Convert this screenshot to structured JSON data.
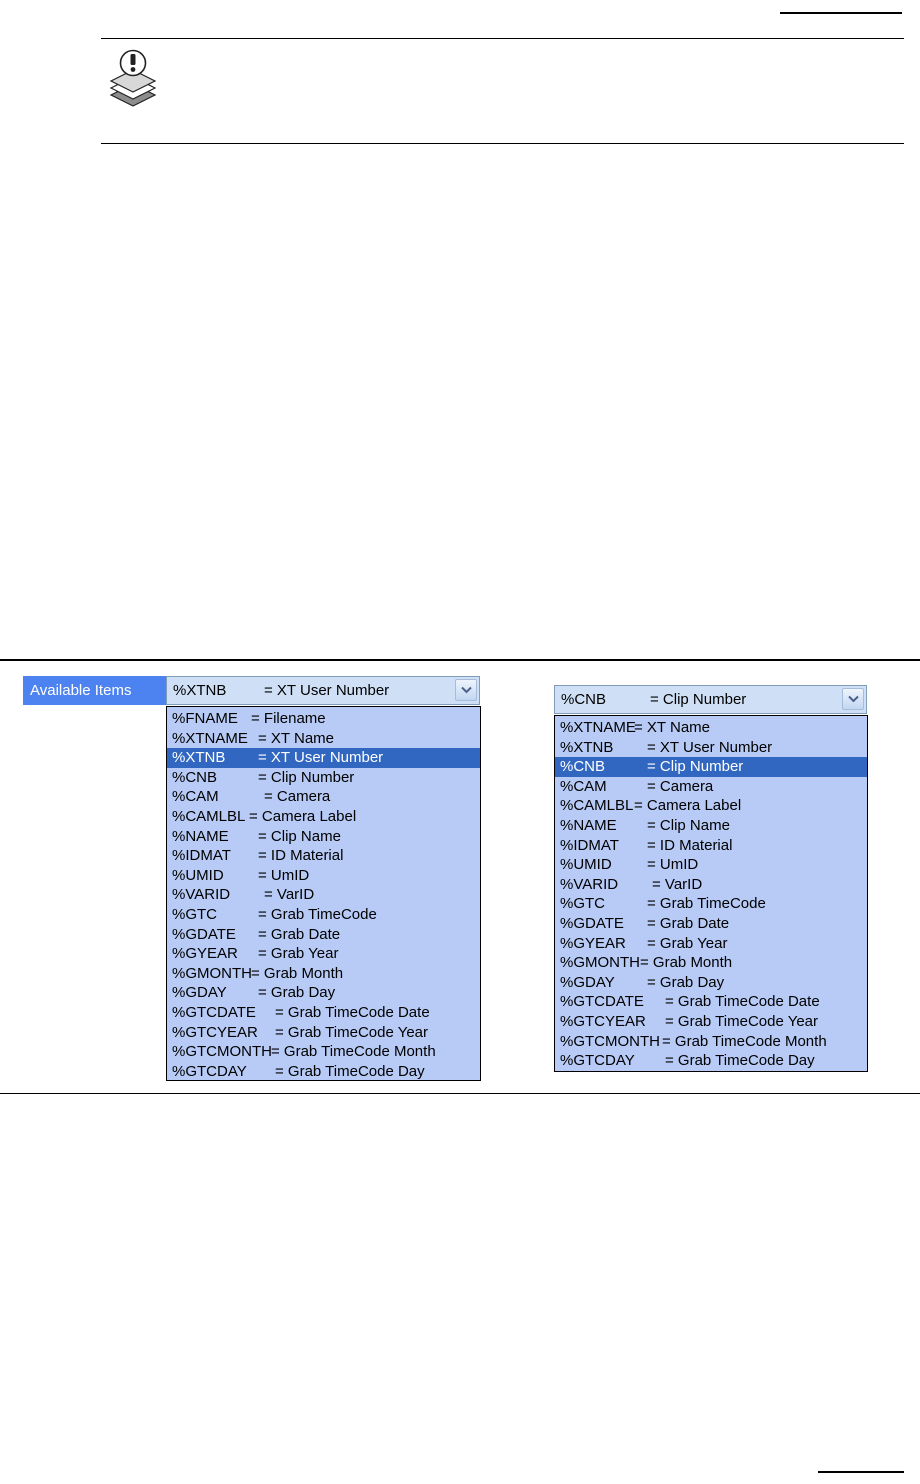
{
  "figure": {
    "label": "Available Items",
    "left_dropdown": {
      "selected": {
        "code": "%XTNB",
        "desc": "= XT User Number"
      },
      "items": [
        {
          "code": "%FNAME",
          "desc": "= Filename"
        },
        {
          "code": "%XTNAME",
          "desc": "= XT Name"
        },
        {
          "code": "%XTNB",
          "desc": "= XT User Number",
          "selected": true
        },
        {
          "code": "%CNB",
          "desc": "= Clip Number"
        },
        {
          "code": "%CAM",
          "desc": "= Camera"
        },
        {
          "code": "%CAMLBL",
          "desc": "= Camera Label"
        },
        {
          "code": "%NAME",
          "desc": "= Clip Name"
        },
        {
          "code": "%IDMAT",
          "desc": "= ID Material"
        },
        {
          "code": "%UMID",
          "desc": "= UmID"
        },
        {
          "code": "%VARID",
          "desc": "= VarID"
        },
        {
          "code": "%GTC",
          "desc": "= Grab TimeCode"
        },
        {
          "code": "%GDATE",
          "desc": "= Grab Date"
        },
        {
          "code": "%GYEAR",
          "desc": "= Grab Year"
        },
        {
          "code": "%GMONTH",
          "desc": "= Grab Month"
        },
        {
          "code": "%GDAY",
          "desc": "= Grab Day"
        },
        {
          "code": "%GTCDATE",
          "desc": "= Grab TimeCode Date"
        },
        {
          "code": "%GTCYEAR",
          "desc": "= Grab TimeCode Year"
        },
        {
          "code": "%GTCMONTH",
          "desc": "= Grab TimeCode Month"
        },
        {
          "code": "%GTCDAY",
          "desc": "= Grab TimeCode Day"
        }
      ]
    },
    "right_dropdown": {
      "selected": {
        "code": "%CNB",
        "desc": "= Clip Number"
      },
      "items": [
        {
          "code": "%XTNAME",
          "desc": "= XT Name"
        },
        {
          "code": "%XTNB",
          "desc": "= XT User Number"
        },
        {
          "code": "%CNB",
          "desc": "= Clip Number",
          "selected": true
        },
        {
          "code": "%CAM",
          "desc": "= Camera"
        },
        {
          "code": "%CAMLBL",
          "desc": "= Camera Label"
        },
        {
          "code": "%NAME",
          "desc": "= Clip Name"
        },
        {
          "code": "%IDMAT",
          "desc": "= ID Material"
        },
        {
          "code": "%UMID",
          "desc": "= UmID"
        },
        {
          "code": "%VARID",
          "desc": "= VarID"
        },
        {
          "code": "%GTC",
          "desc": "= Grab TimeCode"
        },
        {
          "code": "%GDATE",
          "desc": "= Grab Date"
        },
        {
          "code": "%GYEAR",
          "desc": "= Grab Year"
        },
        {
          "code": "%GMONTH",
          "desc": "= Grab Month"
        },
        {
          "code": "%GDAY",
          "desc": "= Grab Day"
        },
        {
          "code": "%GTCDATE",
          "desc": "= Grab TimeCode Date"
        },
        {
          "code": "%GTCYEAR",
          "desc": "= Grab TimeCode Year"
        },
        {
          "code": "%GTCMONTH",
          "desc": "= Grab TimeCode Month"
        },
        {
          "code": "%GTCDAY",
          "desc": "= Grab TimeCode Day"
        }
      ]
    }
  },
  "colors": {
    "label_bg": "#4d83f1",
    "list_bg": "#b7cbf6",
    "selected_bg": "#3167c1",
    "field_bg": "#cfe0f6"
  },
  "icons": {
    "note": "note-stack-icon",
    "dropdown": "chevron-down-icon"
  }
}
